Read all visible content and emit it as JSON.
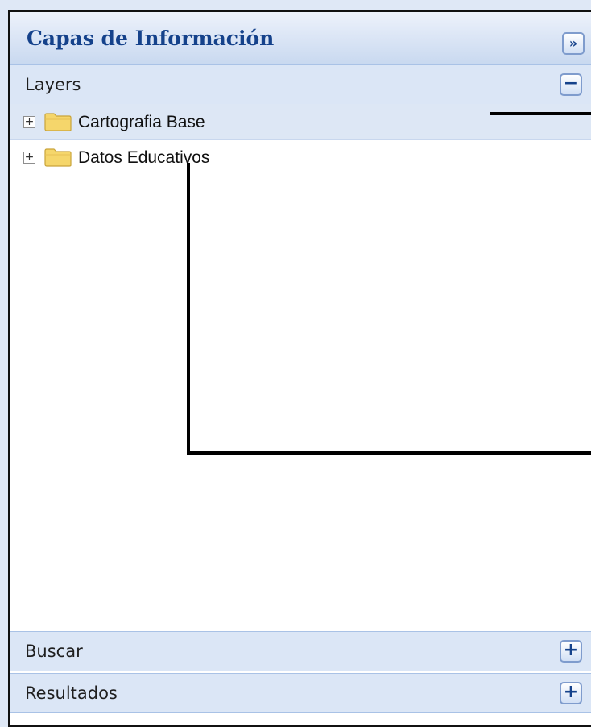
{
  "panel": {
    "title": "Capas de Información",
    "collapse_icon": "»"
  },
  "sections": {
    "layers": {
      "label": "Layers",
      "toggle_icon": "−"
    },
    "buscar": {
      "label": "Buscar",
      "toggle_icon": "+"
    },
    "resultados": {
      "label": "Resultados",
      "toggle_icon": "+"
    }
  },
  "tree": {
    "nodes": [
      {
        "label": "Cartografia Base",
        "expander": "+",
        "selected": true
      },
      {
        "label": "Datos Educativos",
        "expander": "+",
        "selected": false
      }
    ]
  },
  "colors": {
    "title": "#15428b",
    "header_bg": "#dbe6f6",
    "selected_row": "#dde7f5",
    "folder": "#f5d66b"
  }
}
